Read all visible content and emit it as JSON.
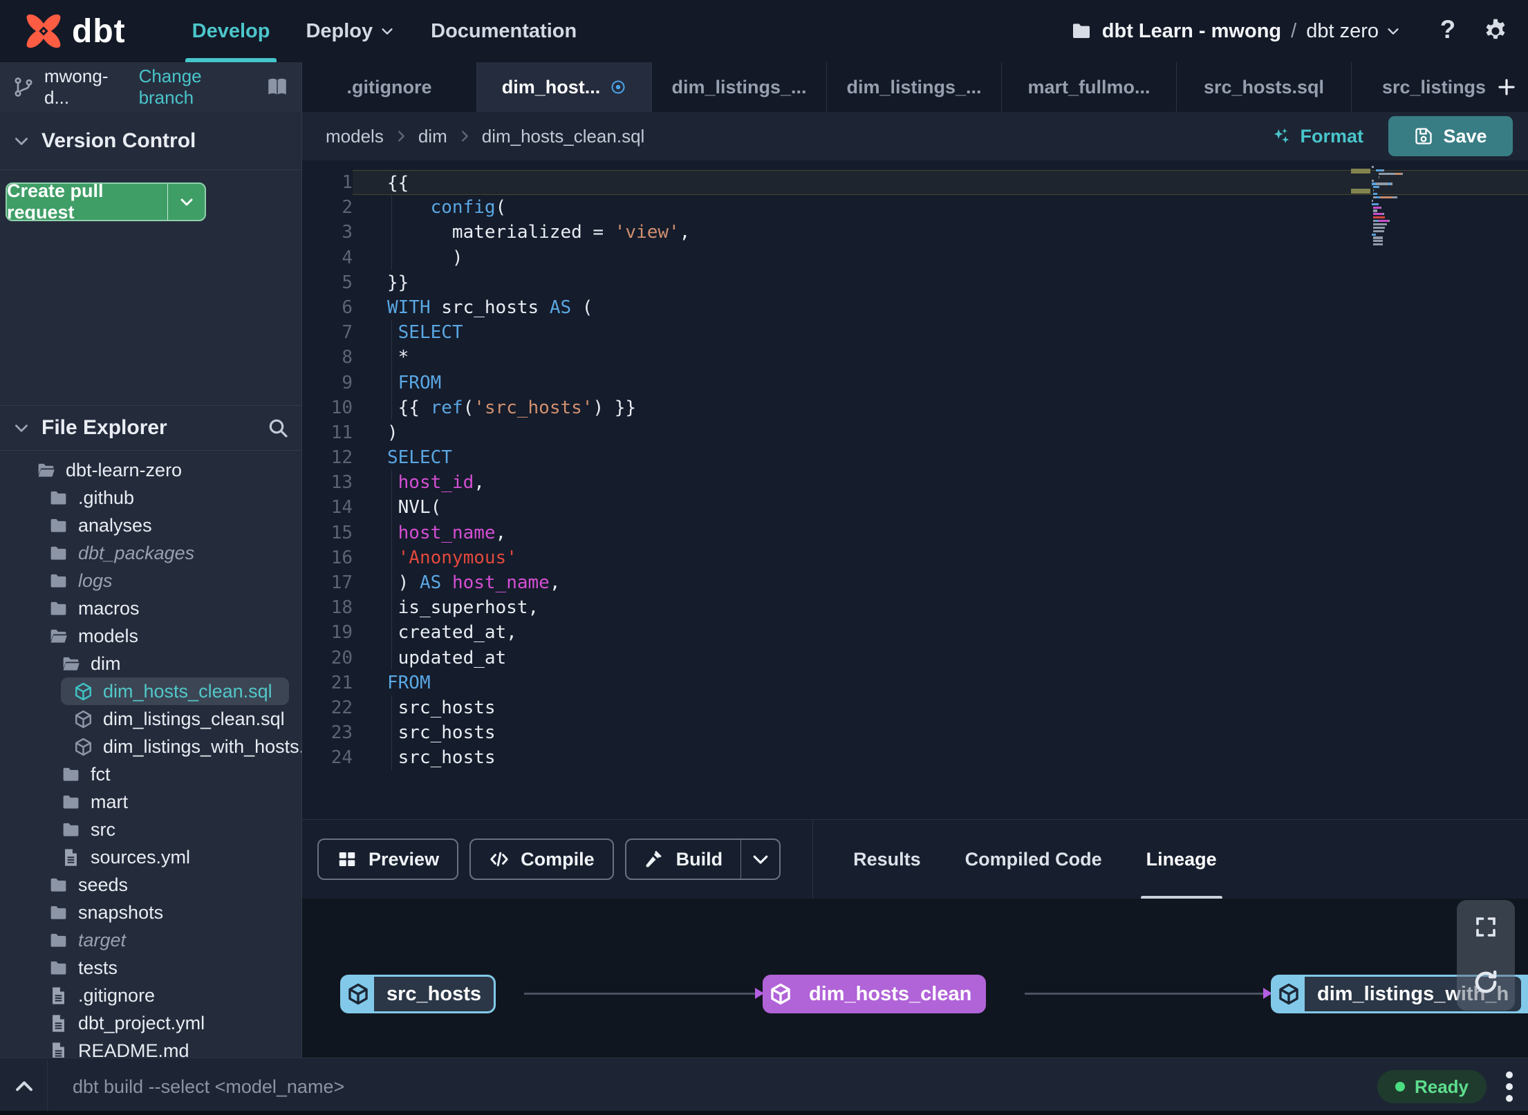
{
  "colors": {
    "accent_teal": "#46c6cb",
    "button_green": "#3f9e66",
    "save_teal": "#397d84",
    "node_blue": "#82c9e9",
    "node_purple": "#b163d8",
    "status_green": "#4ade80",
    "code_keyword": "#5aa7e3",
    "code_column": "#d44fd4",
    "code_string": "#e2493d",
    "code_jinja_string": "#d0906f"
  },
  "topnav": {
    "brand": "dbt",
    "items": [
      {
        "label": "Develop",
        "active": true,
        "caret": false
      },
      {
        "label": "Deploy",
        "active": false,
        "caret": true
      },
      {
        "label": "Documentation",
        "active": false,
        "caret": false
      }
    ],
    "project_name": "dbt Learn - mwong",
    "project_sep": "/",
    "environment": "dbt zero"
  },
  "branch_bar": {
    "branch_name": "mwong-d...",
    "change_branch_label": "Change branch"
  },
  "editor_tabs": [
    {
      "label": ".gitignore"
    },
    {
      "label": "dim_host...",
      "active": true,
      "modified": true
    },
    {
      "label": "dim_listings_..."
    },
    {
      "label": "dim_listings_..."
    },
    {
      "label": "mart_fullmo..."
    },
    {
      "label": "src_hosts.sql"
    },
    {
      "label": "src_listings.",
      "clipped": true
    }
  ],
  "version_control": {
    "title": "Version Control",
    "create_pr_label": "Create pull request"
  },
  "file_explorer": {
    "title": "File Explorer",
    "tree": [
      {
        "name": "dbt-learn-zero",
        "icon": "folder-open",
        "depth": 0
      },
      {
        "name": ".github",
        "icon": "folder",
        "depth": 1
      },
      {
        "name": "analyses",
        "icon": "folder",
        "depth": 1
      },
      {
        "name": "dbt_packages",
        "icon": "folder",
        "depth": 1,
        "italic": true
      },
      {
        "name": "logs",
        "icon": "folder",
        "depth": 1,
        "italic": true
      },
      {
        "name": "macros",
        "icon": "folder",
        "depth": 1
      },
      {
        "name": "models",
        "icon": "folder-open",
        "depth": 1
      },
      {
        "name": "dim",
        "icon": "folder-open",
        "depth": 2
      },
      {
        "name": "dim_hosts_clean.sql",
        "icon": "model",
        "depth": 3,
        "selected": true,
        "modified": true
      },
      {
        "name": "dim_listings_clean.sql",
        "icon": "model",
        "depth": 3
      },
      {
        "name": "dim_listings_with_hosts...",
        "icon": "model",
        "depth": 3
      },
      {
        "name": "fct",
        "icon": "folder",
        "depth": 2
      },
      {
        "name": "mart",
        "icon": "folder",
        "depth": 2
      },
      {
        "name": "src",
        "icon": "folder",
        "depth": 2
      },
      {
        "name": "sources.yml",
        "icon": "file",
        "depth": 2
      },
      {
        "name": "seeds",
        "icon": "folder",
        "depth": 1
      },
      {
        "name": "snapshots",
        "icon": "folder",
        "depth": 1
      },
      {
        "name": "target",
        "icon": "folder",
        "depth": 1,
        "italic": true
      },
      {
        "name": "tests",
        "icon": "folder",
        "depth": 1
      },
      {
        "name": ".gitignore",
        "icon": "file",
        "depth": 1
      },
      {
        "name": "dbt_project.yml",
        "icon": "file",
        "depth": 1
      },
      {
        "name": "README.md",
        "icon": "file",
        "depth": 1
      }
    ]
  },
  "breadcrumb": {
    "items": [
      "models",
      "dim",
      "dim_hosts_clean.sql"
    ]
  },
  "editor_actions": {
    "format_label": "Format",
    "save_label": "Save"
  },
  "code": {
    "ruler_marks": [
      0,
      6
    ],
    "lines": [
      {
        "n": 1,
        "current": true,
        "segs": [
          [
            "{{",
            "pl"
          ]
        ]
      },
      {
        "n": 2,
        "guide": true,
        "segs": [
          [
            "    ",
            "pl"
          ],
          [
            "config",
            "kw"
          ],
          [
            "(",
            "pl"
          ]
        ]
      },
      {
        "n": 3,
        "guide": true,
        "segs": [
          [
            "      materialized = ",
            "pl"
          ],
          [
            "'view'",
            "sj"
          ],
          [
            ",",
            "pl"
          ]
        ]
      },
      {
        "n": 4,
        "guide": true,
        "segs": [
          [
            "      )",
            "pl"
          ]
        ]
      },
      {
        "n": 5,
        "segs": [
          [
            "}}",
            "pl"
          ]
        ]
      },
      {
        "n": 6,
        "segs": [
          [
            "WITH",
            "kw"
          ],
          [
            " src_hosts ",
            "pl"
          ],
          [
            "AS",
            "kw"
          ],
          [
            " (",
            "pl"
          ]
        ]
      },
      {
        "n": 7,
        "guide": true,
        "segs": [
          [
            " ",
            "pl"
          ],
          [
            "SELECT",
            "kw"
          ]
        ]
      },
      {
        "n": 8,
        "guide": true,
        "segs": [
          [
            " *",
            "pl"
          ]
        ]
      },
      {
        "n": 9,
        "guide": true,
        "segs": [
          [
            " ",
            "pl"
          ],
          [
            "FROM",
            "kw"
          ]
        ]
      },
      {
        "n": 10,
        "guide": true,
        "segs": [
          [
            " {{ ",
            "pl"
          ],
          [
            "ref",
            "kw"
          ],
          [
            "(",
            "pl"
          ],
          [
            "'src_hosts'",
            "sj"
          ],
          [
            ") }}",
            "pl"
          ]
        ]
      },
      {
        "n": 11,
        "segs": [
          [
            ")",
            "pl"
          ]
        ]
      },
      {
        "n": 12,
        "segs": [
          [
            "SELECT",
            "kw"
          ]
        ]
      },
      {
        "n": 13,
        "guide": true,
        "segs": [
          [
            " ",
            "pl"
          ],
          [
            "host_id",
            "co"
          ],
          [
            ",",
            "pl"
          ]
        ]
      },
      {
        "n": 14,
        "guide": true,
        "segs": [
          [
            " NVL(",
            "pl"
          ]
        ]
      },
      {
        "n": 15,
        "guide": true,
        "segs": [
          [
            " ",
            "pl"
          ],
          [
            "host_name",
            "co"
          ],
          [
            ",",
            "pl"
          ]
        ]
      },
      {
        "n": 16,
        "guide": true,
        "segs": [
          [
            " ",
            "pl"
          ],
          [
            "'Anonymous'",
            "st"
          ]
        ]
      },
      {
        "n": 17,
        "guide": true,
        "segs": [
          [
            " ) ",
            "pl"
          ],
          [
            "AS",
            "kw"
          ],
          [
            " ",
            "pl"
          ],
          [
            "host_name",
            "co"
          ],
          [
            ",",
            "pl"
          ]
        ]
      },
      {
        "n": 18,
        "guide": true,
        "segs": [
          [
            " is_superhost,",
            "pl"
          ]
        ]
      },
      {
        "n": 19,
        "guide": true,
        "segs": [
          [
            " created_at,",
            "pl"
          ]
        ]
      },
      {
        "n": 20,
        "guide": true,
        "segs": [
          [
            " updated_at",
            "pl"
          ]
        ]
      },
      {
        "n": 21,
        "segs": [
          [
            "FROM",
            "kw"
          ]
        ]
      },
      {
        "n": 22,
        "guide": true,
        "segs": [
          [
            " src_hosts",
            "pl"
          ]
        ]
      },
      {
        "n": 23,
        "guide": true,
        "segs": [
          [
            " src_hosts",
            "pl"
          ]
        ]
      },
      {
        "n": 24,
        "guide": true,
        "segs": [
          [
            " src_hosts",
            "pl"
          ]
        ]
      }
    ]
  },
  "bottom_panel": {
    "buttons": [
      {
        "label": "Preview",
        "icon": "grid"
      },
      {
        "label": "Compile",
        "icon": "code"
      },
      {
        "label": "Build",
        "icon": "hammer",
        "split": true
      }
    ],
    "tabs": [
      {
        "label": "Results"
      },
      {
        "label": "Compiled Code"
      },
      {
        "label": "Lineage",
        "active": true
      }
    ]
  },
  "lineage": {
    "nodes": [
      {
        "name": "src_hosts",
        "variant": "outlined"
      },
      {
        "name": "dim_hosts_clean",
        "variant": "purple"
      },
      {
        "name": "dim_listings_with_h",
        "variant": "outlined"
      }
    ]
  },
  "command_bar": {
    "command_text": "dbt build --select <model_name>",
    "status_label": "Ready"
  }
}
